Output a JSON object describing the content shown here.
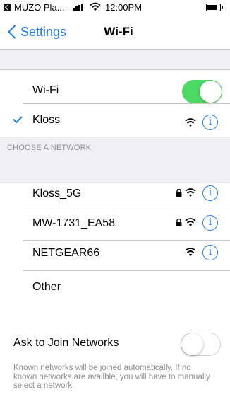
{
  "status_bar": {
    "app_name": "MUZO Pla...",
    "time": "12:00PM"
  },
  "nav": {
    "back_label": "Settings",
    "title": "Wi-Fi"
  },
  "wifi_toggle": {
    "label": "Wi-Fi",
    "state": "on"
  },
  "connected_network": {
    "name": "Kloss"
  },
  "choose_network": {
    "header": "CHOOSE A NETWORK",
    "networks": [
      {
        "name": "Kloss_5G",
        "locked": true
      },
      {
        "name": "MW-1731_EA58",
        "locked": true
      },
      {
        "name": "NETGEAR66",
        "locked": false
      }
    ],
    "other_label": "Other"
  },
  "ask_to_join": {
    "label": "Ask to Join Networks",
    "state": "off",
    "footnote": "Known networks will be joined automatically. If no known networks are availble, you will have to manually select a network."
  },
  "colors": {
    "accent": "#1e7cf2",
    "toggle_on": "#4cd964",
    "group_background": "#efeff4",
    "secondary_text": "#8e8e93"
  }
}
